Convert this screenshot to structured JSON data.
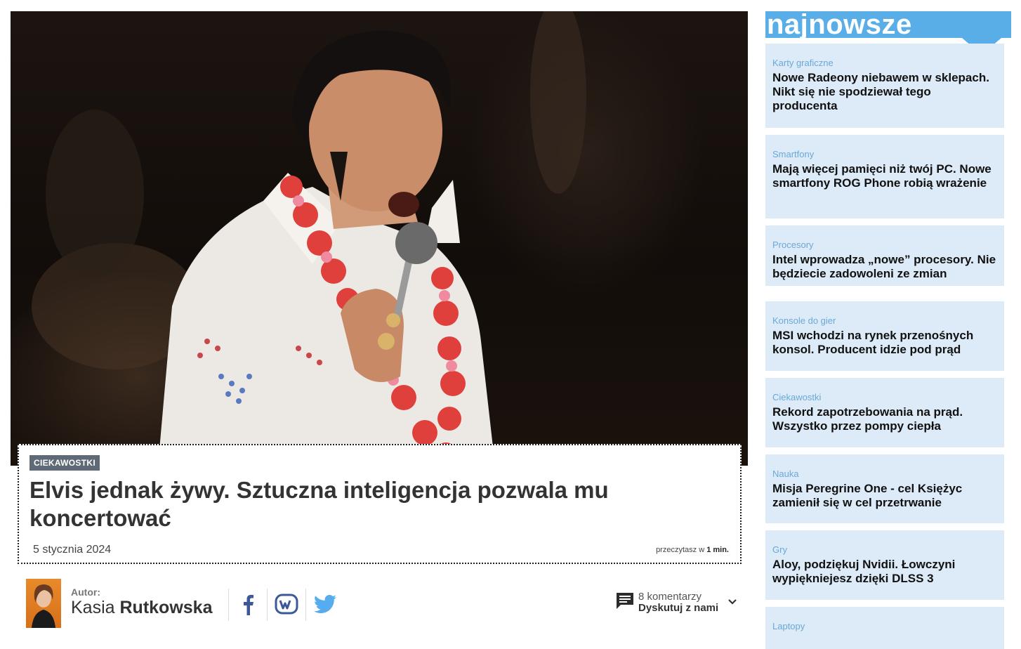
{
  "article": {
    "category": "CIEKAWOSTKI",
    "title": "Elvis jednak żywy. Sztuczna inteligencja pozwala mu koncertować",
    "date": "5 stycznia 2024",
    "read_time_prefix": "przeczytasz w",
    "read_time_value": "1 min."
  },
  "author": {
    "label": "Autor:",
    "first_name": "Kasia",
    "last_name": "Rutkowska"
  },
  "social": {
    "icons": [
      "facebook-icon",
      "wykop-icon",
      "twitter-icon"
    ]
  },
  "comments": {
    "count": "8 komentarzy",
    "cta": "Dyskutuj z nami"
  },
  "sidebar": {
    "title": "najnowsze",
    "accent_color": "#5aaee8",
    "card_color": "#dcebf7",
    "items": [
      {
        "category": "Karty graficzne",
        "headline": "Nowe Radeony niebawem w sklepach. Nikt się nie spodziewał tego producenta"
      },
      {
        "category": "Smartfony",
        "headline": "Mają więcej pamięci niż twój PC. Nowe smartfony ROG Phone robią wrażenie"
      },
      {
        "category": "Procesory",
        "headline": "Intel wprowadza „nowe” procesory. Nie będziecie zadowoleni ze zmian"
      },
      {
        "category": "Konsole do gier",
        "headline": "MSI wchodzi na rynek przenośnych konsol. Producent idzie pod prąd"
      },
      {
        "category": "Ciekawostki",
        "headline": "Rekord zapotrzebowania na prąd. Wszystko przez pompy ciepła"
      },
      {
        "category": "Nauka",
        "headline": "Misja Peregrine One - cel Księżyc zamienił się w cel przetrwanie"
      },
      {
        "category": "Gry",
        "headline": "Aloy, podziękuj Nvidii. Łowczyni wypiękniejesz dzięki DLSS 3"
      },
      {
        "category": "Laptopy",
        "headline": ""
      }
    ]
  }
}
